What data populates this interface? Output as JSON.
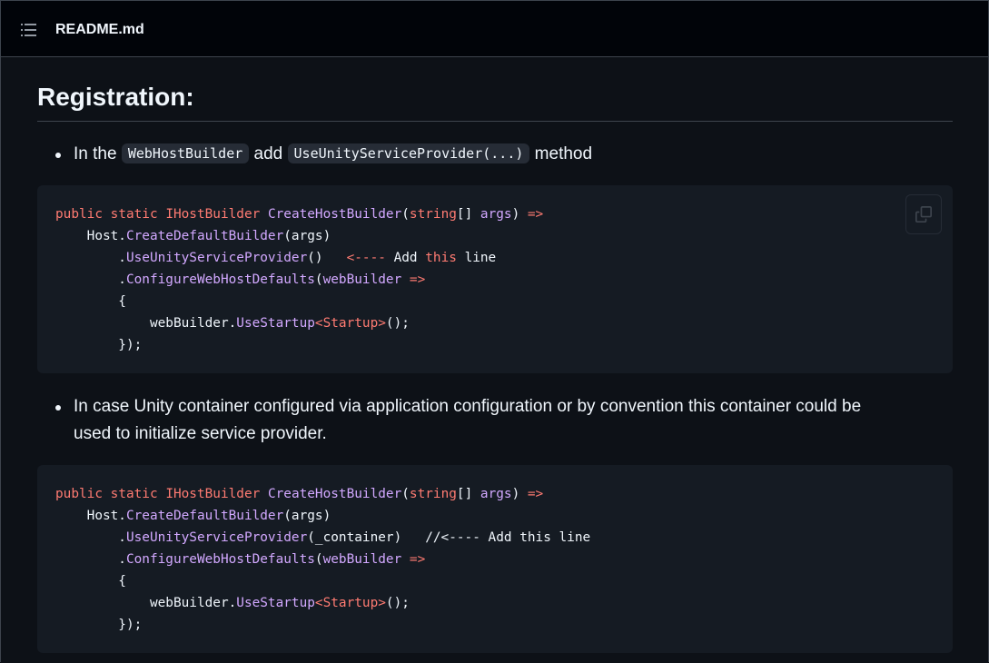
{
  "header": {
    "file_title": "README.md",
    "toc_icon": "list-unordered-icon"
  },
  "heading": "Registration:",
  "bullets": [
    {
      "prefix": "In the ",
      "code1": "WebHostBuilder",
      "middle": " add ",
      "code2": "UseUnityServiceProvider(...)",
      "suffix": " method"
    },
    {
      "line1": "In case Unity container configured via application configuration or by convention this container could be",
      "line2": "used to initialize service provider."
    }
  ],
  "code_blocks": [
    {
      "copy_icon": "copy-icon",
      "lines": [
        [
          [
            "kw",
            "public"
          ],
          [
            "pl",
            " "
          ],
          [
            "kw",
            "static"
          ],
          [
            "pl",
            " "
          ],
          [
            "ty",
            "IHostBuilder"
          ],
          [
            "pl",
            " "
          ],
          [
            "fn",
            "CreateHostBuilder"
          ],
          [
            "pl",
            "("
          ],
          [
            "kw",
            "string"
          ],
          [
            "pl",
            "[] "
          ],
          [
            "fn",
            "args"
          ],
          [
            "pl",
            ") "
          ],
          [
            "kw",
            "=>"
          ]
        ],
        [
          [
            "pl",
            "    Host."
          ],
          [
            "fn",
            "CreateDefaultBuilder"
          ],
          [
            "pl",
            "(args)"
          ]
        ],
        [
          [
            "pl",
            "        ."
          ],
          [
            "fn",
            "UseUnityServiceProvider"
          ],
          [
            "pl",
            "()   "
          ],
          [
            "kw",
            "<----"
          ],
          [
            "pl",
            " Add "
          ],
          [
            "kw",
            "this"
          ],
          [
            "pl",
            " line"
          ]
        ],
        [
          [
            "pl",
            "        ."
          ],
          [
            "fn",
            "ConfigureWebHostDefaults"
          ],
          [
            "pl",
            "("
          ],
          [
            "fn",
            "webBuilder"
          ],
          [
            "pl",
            " "
          ],
          [
            "kw",
            "=>"
          ]
        ],
        [
          [
            "pl",
            "        {"
          ]
        ],
        [
          [
            "pl",
            "            webBuilder."
          ],
          [
            "fn",
            "UseStartup"
          ],
          [
            "kw",
            "<"
          ],
          [
            "ty",
            "Startup"
          ],
          [
            "kw",
            ">"
          ],
          [
            "pl",
            "();"
          ]
        ],
        [
          [
            "pl",
            "        });"
          ]
        ]
      ]
    },
    {
      "copy_icon": "copy-icon",
      "lines": [
        [
          [
            "kw",
            "public"
          ],
          [
            "pl",
            " "
          ],
          [
            "kw",
            "static"
          ],
          [
            "pl",
            " "
          ],
          [
            "ty",
            "IHostBuilder"
          ],
          [
            "pl",
            " "
          ],
          [
            "fn",
            "CreateHostBuilder"
          ],
          [
            "pl",
            "("
          ],
          [
            "kw",
            "string"
          ],
          [
            "pl",
            "[] "
          ],
          [
            "fn",
            "args"
          ],
          [
            "pl",
            ") "
          ],
          [
            "kw",
            "=>"
          ]
        ],
        [
          [
            "pl",
            "    Host."
          ],
          [
            "fn",
            "CreateDefaultBuilder"
          ],
          [
            "pl",
            "(args)"
          ]
        ],
        [
          [
            "pl",
            "        ."
          ],
          [
            "fn",
            "UseUnityServiceProvider"
          ],
          [
            "pl",
            "(_container)   "
          ],
          [
            "cm",
            "//<---- Add this line"
          ]
        ],
        [
          [
            "pl",
            "        ."
          ],
          [
            "fn",
            "ConfigureWebHostDefaults"
          ],
          [
            "pl",
            "("
          ],
          [
            "fn",
            "webBuilder"
          ],
          [
            "pl",
            " "
          ],
          [
            "kw",
            "=>"
          ]
        ],
        [
          [
            "pl",
            "        {"
          ]
        ],
        [
          [
            "pl",
            "            webBuilder."
          ],
          [
            "fn",
            "UseStartup"
          ],
          [
            "kw",
            "<"
          ],
          [
            "ty",
            "Startup"
          ],
          [
            "kw",
            ">"
          ],
          [
            "pl",
            "();"
          ]
        ],
        [
          [
            "pl",
            "        });"
          ]
        ]
      ]
    }
  ],
  "colors": {
    "background": "#0d1117",
    "header_bg": "#010409",
    "code_bg": "#151b23",
    "keyword": "#ff7b72",
    "function": "#d2a8ff",
    "text": "#f0f6fc"
  }
}
